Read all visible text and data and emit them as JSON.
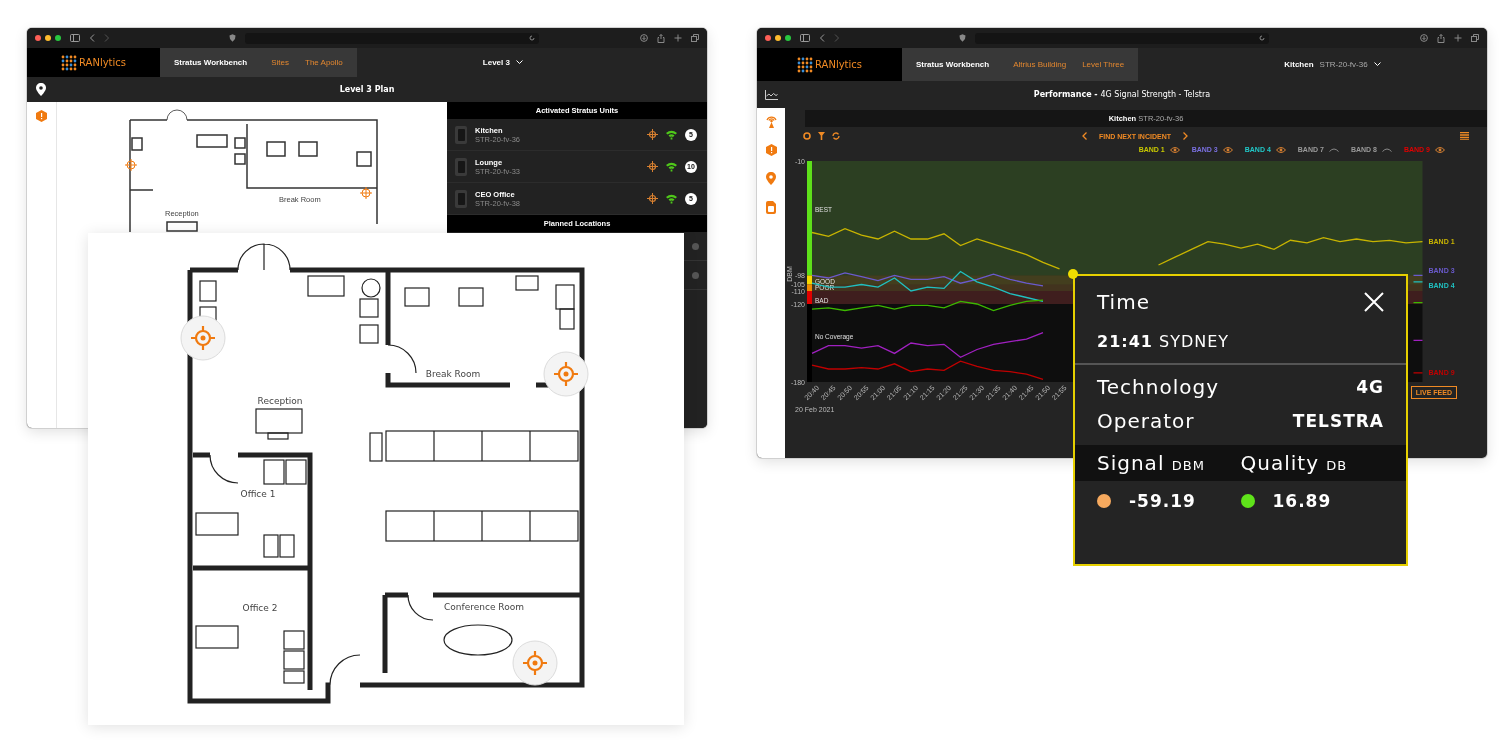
{
  "left_window": {
    "header": {
      "logo": "RANlytics",
      "tabs": [
        {
          "label": "Stratus Workbench",
          "selected": true
        },
        {
          "label": "Sites",
          "selected": false
        },
        {
          "label": "The Apollo",
          "selected": false
        }
      ],
      "level_select": "Level 3"
    },
    "page_title": "Level 3 Plan",
    "plan_labels": [
      "Break Room",
      "Reception"
    ],
    "units_panel": {
      "title": "Activated Stratus Units",
      "units": [
        {
          "name": "Kitchen",
          "id": "STR-20-fv-36",
          "badge": "5"
        },
        {
          "name": "Lounge",
          "id": "STR-20-fv-33",
          "badge": "10"
        },
        {
          "name": "CEO Office",
          "id": "STR-20-fv-38",
          "badge": "5"
        }
      ],
      "planned_title": "Planned Locations"
    }
  },
  "floor_plan_card": {
    "rooms": [
      {
        "kind": "reception",
        "label": "Reception"
      },
      {
        "kind": "break",
        "label": "Break Room"
      },
      {
        "kind": "office1",
        "label": "Office 1"
      },
      {
        "kind": "office2",
        "label": "Office 2"
      },
      {
        "kind": "conference",
        "label": "Conference Room"
      }
    ]
  },
  "right_window": {
    "header": {
      "logo": "RANlytics",
      "tabs": [
        {
          "label": "Stratus Workbench",
          "selected": true
        },
        {
          "label": "Altrius Building",
          "selected": false
        },
        {
          "label": "Level Three",
          "selected": false
        }
      ],
      "unit_select": {
        "name": "Kitchen",
        "id": "STR-20-fv-36"
      }
    },
    "page_title": {
      "bold": "Performance -",
      "rest": "4G Signal Strength - Telstra"
    },
    "unit_bar": {
      "name": "Kitchen",
      "id": "STR-20-fv-36"
    },
    "find_incident": "FIND NEXT INCIDENT",
    "legend": [
      {
        "label": "BAND 1",
        "color": "#c8c800",
        "visible": true
      },
      {
        "label": "BAND 3",
        "color": "#7a70e0",
        "visible": true
      },
      {
        "label": "BAND 4",
        "color": "#20c8c8",
        "visible": true
      },
      {
        "label": "BAND 7",
        "color": "#9a9a9a",
        "visible": false
      },
      {
        "label": "BAND 8",
        "color": "#9a9a9a",
        "visible": false
      },
      {
        "label": "BAND 9",
        "color": "#e00000",
        "visible": true
      }
    ],
    "date": "20 Feb 2021",
    "chart_data": {
      "type": "line",
      "ylabel": "DBM",
      "legend": "right",
      "bands": [
        {
          "axis": "y",
          "from": -10,
          "to": -98,
          "label": "BEST",
          "color": "#5ee01a"
        },
        {
          "axis": "y",
          "from": -98,
          "to": -105,
          "label": "GOOD",
          "color": "#f5d800"
        },
        {
          "axis": "y",
          "from": -105,
          "to": -110,
          "label": "POOR",
          "color": "#f08a00"
        },
        {
          "axis": "y",
          "from": -110,
          "to": -120,
          "label": "BAD",
          "color": "#e00000"
        },
        {
          "axis": "y",
          "from": -120,
          "to": -180,
          "label": "No Coverage",
          "color": "#000000"
        }
      ],
      "categories": [
        "20:40",
        "20:45",
        "20:50",
        "20:55",
        "21:00",
        "21:05",
        "21:10",
        "21:15",
        "21:20",
        "21:25",
        "21:30",
        "21:35",
        "21:40",
        "21:45",
        "21:50",
        "21:55",
        null,
        null,
        null,
        null,
        null,
        null,
        null,
        null,
        null,
        null,
        null,
        null,
        null,
        null,
        null,
        null,
        null,
        null,
        null,
        null,
        null,
        null
      ],
      "ylim": [
        -180,
        -10
      ],
      "yticks": [
        -10,
        -98,
        -105,
        -110,
        -120,
        -180
      ],
      "series": [
        {
          "name": "BAND 1",
          "color": "#c8b400",
          "values": [
            -65,
            -68,
            -62,
            -67,
            -70,
            -64,
            -70,
            -70,
            -66,
            -75,
            -70,
            -74,
            -78,
            -82,
            -88,
            -93,
            null,
            null,
            null,
            null,
            null,
            -90,
            -84,
            -78,
            -72,
            -74,
            -77,
            -74,
            -78,
            -71,
            -73,
            -69,
            -72,
            -70,
            -72,
            -71,
            -73,
            -72
          ]
        },
        {
          "name": "BAND 3",
          "color": "#6a5acd",
          "values": [
            -98,
            -100,
            -96,
            -99,
            -102,
            -98,
            -101,
            -101,
            -99,
            -104,
            -101,
            -97,
            -101,
            -104,
            -106,
            null,
            null,
            null,
            null,
            null,
            null,
            null,
            null,
            null,
            null,
            null,
            null,
            null,
            null,
            null,
            null,
            null,
            null,
            null,
            null,
            null,
            null,
            -98
          ]
        },
        {
          "name": "BAND 4",
          "color": "#20c0c0",
          "values": [
            -104,
            -107,
            -107,
            -105,
            -107,
            -100,
            -110,
            -107,
            -108,
            -95,
            -103,
            -107,
            -112,
            -115,
            -118,
            null,
            null,
            null,
            null,
            null,
            null,
            null,
            null,
            null,
            null,
            null,
            null,
            null,
            null,
            null,
            null,
            null,
            null,
            null,
            null,
            null,
            null,
            -103
          ]
        },
        {
          "color": "#3cb800",
          "values": [
            -124,
            -123,
            -125,
            -123,
            -121,
            -124,
            -121,
            -121,
            -123,
            -118,
            -120,
            -125,
            -121,
            -118,
            -117,
            null,
            null,
            null,
            null,
            null,
            null,
            null,
            null,
            null,
            null,
            null,
            null,
            null,
            null,
            null,
            null,
            null,
            null,
            null,
            null,
            null,
            null,
            -119
          ]
        },
        {
          "color": "#a020c0",
          "values": [
            -158,
            -152,
            -152,
            -154,
            -152,
            -158,
            -150,
            -152,
            -151,
            -161,
            -155,
            -151,
            -149,
            -147,
            -142,
            null,
            null,
            null,
            null,
            null,
            null,
            null,
            null,
            null,
            null,
            null,
            null,
            null,
            null,
            null,
            null,
            null,
            null,
            null,
            null,
            null,
            null,
            -148
          ]
        },
        {
          "name": "BAND 9",
          "color": "#c00000",
          "values": [
            -167,
            -170,
            -170,
            -169,
            -170,
            -166,
            -172,
            -170,
            -171,
            -164,
            -168,
            -171,
            -172,
            -174,
            -178,
            null,
            null,
            null,
            null,
            null,
            null,
            null,
            null,
            null,
            null,
            null,
            null,
            null,
            null,
            null,
            null,
            null,
            null,
            null,
            null,
            null,
            null,
            -173
          ]
        }
      ]
    },
    "live_feed": "LIVE FEED"
  },
  "tooltip": {
    "title": "Time",
    "time": "21:41",
    "city": "SYDNEY",
    "rows": [
      {
        "label": "Technology",
        "value": "4G"
      },
      {
        "label": "Operator",
        "value": "TELSTRA"
      }
    ],
    "metrics": [
      {
        "label": "Signal",
        "unit": "DBM",
        "value": "-59.19",
        "color": "#f6a95e"
      },
      {
        "label": "Quality",
        "unit": "DB",
        "value": "16.89",
        "color": "#5fe31a"
      }
    ]
  }
}
